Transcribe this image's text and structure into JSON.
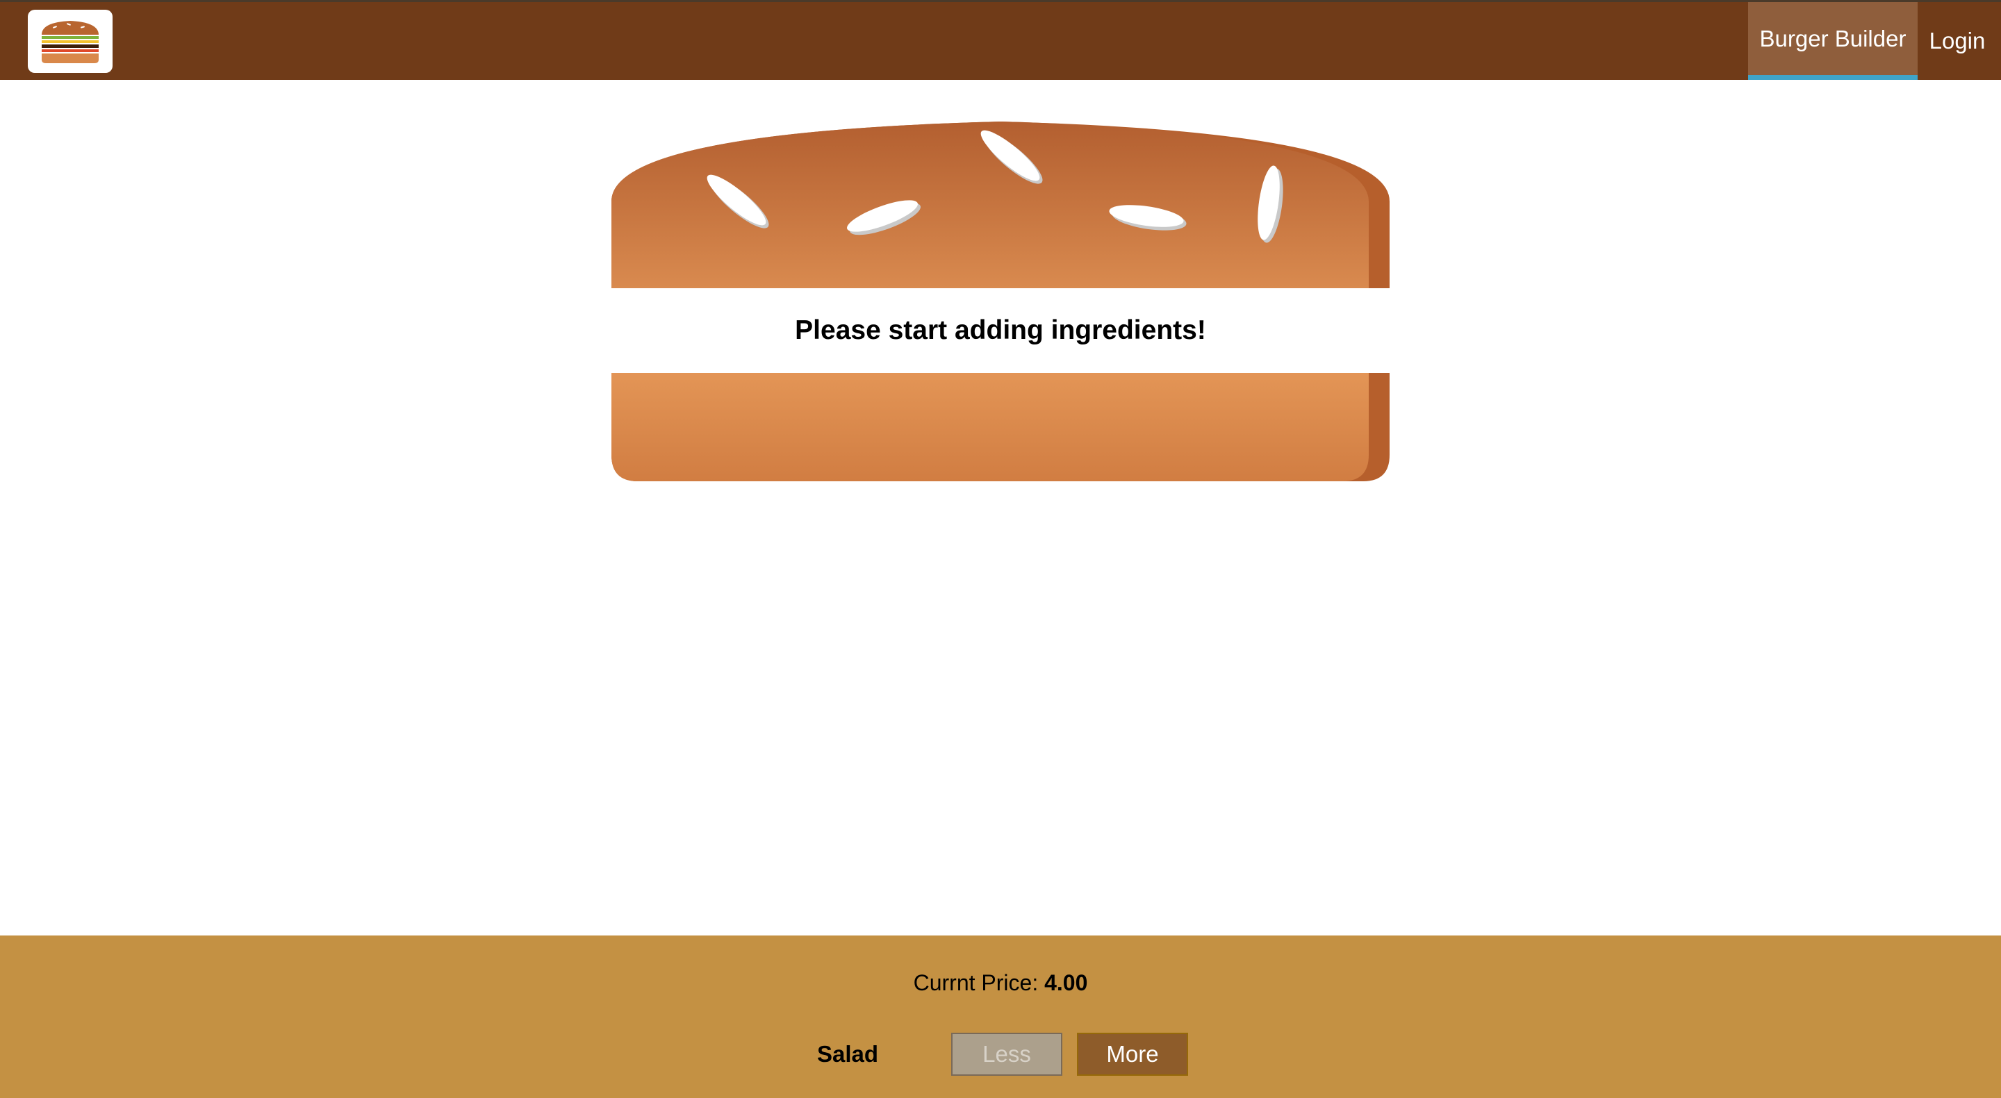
{
  "header": {
    "logo_icon": "burger-logo-icon",
    "nav": [
      {
        "label": "Burger Builder",
        "active": true
      },
      {
        "label": "Login",
        "active": false
      }
    ]
  },
  "burger": {
    "message": "Please start adding ingredients!",
    "bun_icon": "burger-bun-icon"
  },
  "build_controls": {
    "price_label": "Currnt Price:",
    "price_value": "4.00",
    "controls": [
      {
        "label": "Salad",
        "less_label": "Less",
        "more_label": "More",
        "less_disabled": true
      }
    ]
  },
  "colors": {
    "toolbar": "#703b18",
    "nav_active": "#8f5e3c",
    "nav_underline": "#40a4c8",
    "controls_bg": "#c49143",
    "more_button": "#8e5c2a",
    "less_button_disabled": "#aca08c"
  }
}
